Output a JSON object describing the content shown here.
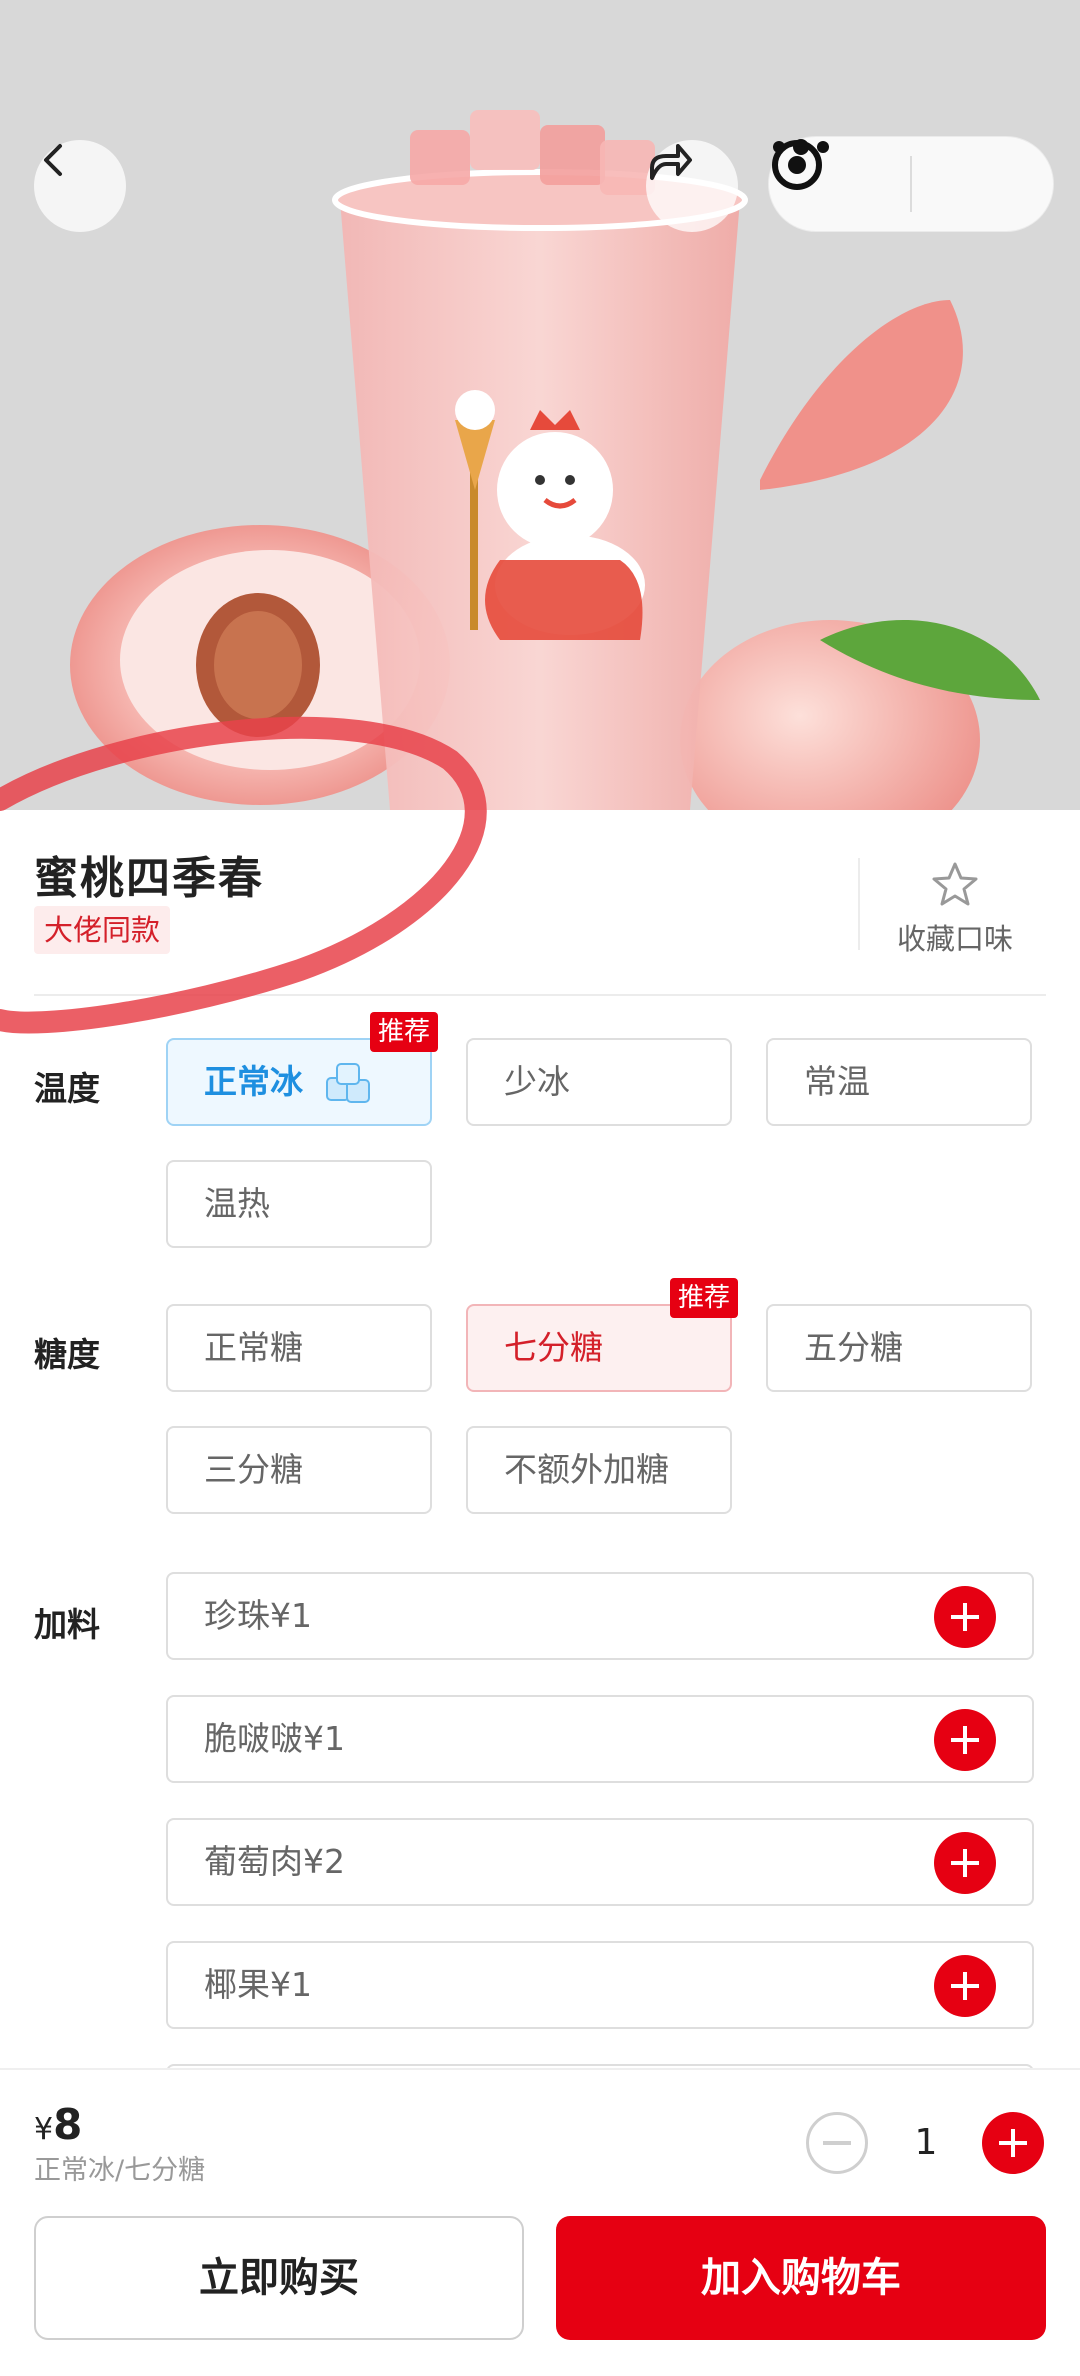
{
  "product": {
    "name": "蜜桃四季春",
    "tag": "大佬同款",
    "favorite_label": "收藏口味"
  },
  "options": {
    "temperature": {
      "label": "温度",
      "badge": "推荐",
      "items": [
        "正常冰",
        "少冰",
        "常温",
        "温热"
      ],
      "selected": "正常冰"
    },
    "sugar": {
      "label": "糖度",
      "badge": "推荐",
      "items": [
        "正常糖",
        "七分糖",
        "五分糖",
        "三分糖",
        "不额外加糖"
      ],
      "selected": "七分糖"
    },
    "toppings": {
      "label": "加料",
      "items": [
        "珍珠¥1",
        "脆啵啵¥1",
        "葡萄肉¥2",
        "椰果¥1"
      ]
    }
  },
  "footer": {
    "currency": "¥",
    "price": "8",
    "spec": "正常冰/七分糖",
    "quantity": "1",
    "buy_now": "立即购买",
    "add_to_cart": "加入购物车"
  },
  "colors": {
    "accent_red": "#e60012",
    "selected_blue": "#1e8fe0",
    "tag_red": "#d4202a"
  },
  "icons": [
    "back-icon",
    "share-icon",
    "more-icon",
    "capsule-record-icon",
    "star-icon",
    "ice-cube-icon",
    "plus-icon",
    "minus-icon"
  ]
}
